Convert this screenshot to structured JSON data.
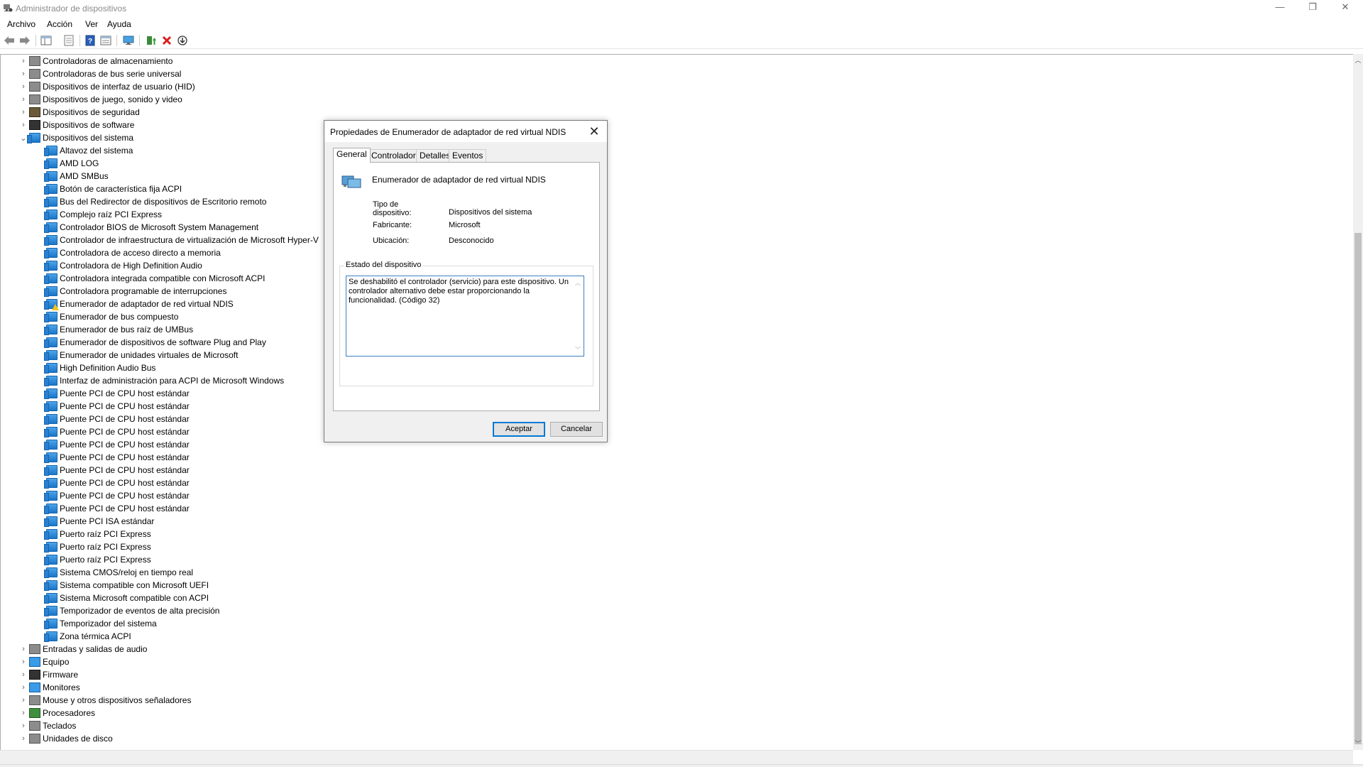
{
  "window": {
    "title": "Administrador de dispositivos",
    "controls": {
      "minimize": "—",
      "restore": "❐",
      "close": "✕"
    }
  },
  "menu": [
    "Archivo",
    "Acción",
    "Ver",
    "Ayuda"
  ],
  "toolbar": {
    "icons": [
      "back-icon",
      "forward-icon",
      "show-hide-tree-icon",
      "properties-icon",
      "help-icon",
      "view-icon",
      "monitor-icon",
      "update-driver-icon",
      "uninstall-icon",
      "download-icon"
    ]
  },
  "tree": {
    "top_categories": [
      {
        "label": "Controladoras de almacenamiento",
        "icon": "storage-icon"
      },
      {
        "label": "Controladoras de bus serie universal",
        "icon": "usb-icon"
      },
      {
        "label": "Dispositivos de interfaz de usuario (HID)",
        "icon": "hid-icon"
      },
      {
        "label": "Dispositivos de juego, sonido y video",
        "icon": "sound-icon"
      },
      {
        "label": "Dispositivos de seguridad",
        "icon": "security-icon"
      },
      {
        "label": "Dispositivos de software",
        "icon": "software-icon"
      }
    ],
    "expanded_category": {
      "label": "Dispositivos del sistema",
      "icon": "folder-icon"
    },
    "system_devices": [
      "Altavoz del sistema",
      "AMD LOG",
      "AMD SMBus",
      "Botón de característica fija ACPI",
      "Bus del Redirector de dispositivos de Escritorio remoto",
      "Complejo raíz PCI Express",
      "Controlador BIOS de Microsoft System Management",
      "Controlador de infraestructura de virtualización de Microsoft Hyper-V",
      "Controladora de acceso directo a memoria",
      "Controladora de High Definition Audio",
      "Controladora integrada compatible con Microsoft ACPI",
      "Controladora programable de interrupciones",
      "Enumerador de adaptador de red virtual NDIS",
      "Enumerador de bus compuesto",
      "Enumerador de bus raíz de UMBus",
      "Enumerador de dispositivos de software Plug and Play",
      "Enumerador de unidades virtuales de Microsoft",
      "High Definition Audio Bus",
      "Interfaz de administración para ACPI de Microsoft Windows",
      "Puente PCI de CPU host estándar",
      "Puente PCI de CPU host estándar",
      "Puente PCI de CPU host estándar",
      "Puente PCI de CPU host estándar",
      "Puente PCI de CPU host estándar",
      "Puente PCI de CPU host estándar",
      "Puente PCI de CPU host estándar",
      "Puente PCI de CPU host estándar",
      "Puente PCI de CPU host estándar",
      "Puente PCI de CPU host estándar",
      "Puente PCI ISA estándar",
      "Puerto raíz PCI Express",
      "Puerto raíz PCI Express",
      "Puerto raíz PCI Express",
      "Sistema CMOS/reloj en tiempo real",
      "Sistema compatible con Microsoft UEFI",
      "Sistema Microsoft compatible con ACPI",
      "Temporizador de eventos de alta precisión",
      "Temporizador del sistema",
      "Zona térmica ACPI"
    ],
    "warning_device": "Enumerador de adaptador de red virtual NDIS",
    "bottom_categories": [
      {
        "label": "Entradas y salidas de audio",
        "icon": "audio-icon"
      },
      {
        "label": "Equipo",
        "icon": "computer-icon"
      },
      {
        "label": "Firmware",
        "icon": "firmware-icon"
      },
      {
        "label": "Monitores",
        "icon": "monitor-icon"
      },
      {
        "label": "Mouse y otros dispositivos señaladores",
        "icon": "mouse-icon"
      },
      {
        "label": "Procesadores",
        "icon": "processor-icon"
      },
      {
        "label": "Teclados",
        "icon": "keyboard-icon"
      },
      {
        "label": "Unidades de disco",
        "icon": "disk-icon"
      }
    ]
  },
  "dialog": {
    "title": "Propiedades de Enumerador de adaptador de red virtual NDIS",
    "tabs": [
      "General",
      "Controlador",
      "Detalles",
      "Eventos"
    ],
    "active_tab": "General",
    "device_name": "Enumerador de adaptador de red virtual NDIS",
    "props": {
      "type_label": "Tipo de dispositivo:",
      "type_value": "Dispositivos del sistema",
      "manufacturer_label": "Fabricante:",
      "manufacturer_value": "Microsoft",
      "location_label": "Ubicación:",
      "location_value": "Desconocido"
    },
    "status_group_label": "Estado del dispositivo",
    "status_text": "Se deshabilitó el controlador (servicio) para este dispositivo. Un controlador alternativo debe estar proporcionando la funcionalidad. (Código 32)",
    "ok_label": "Aceptar",
    "cancel_label": "Cancelar"
  },
  "colors": {
    "accent": "#0078d7",
    "folder": "#1976c9",
    "warning": "#f2c318"
  }
}
